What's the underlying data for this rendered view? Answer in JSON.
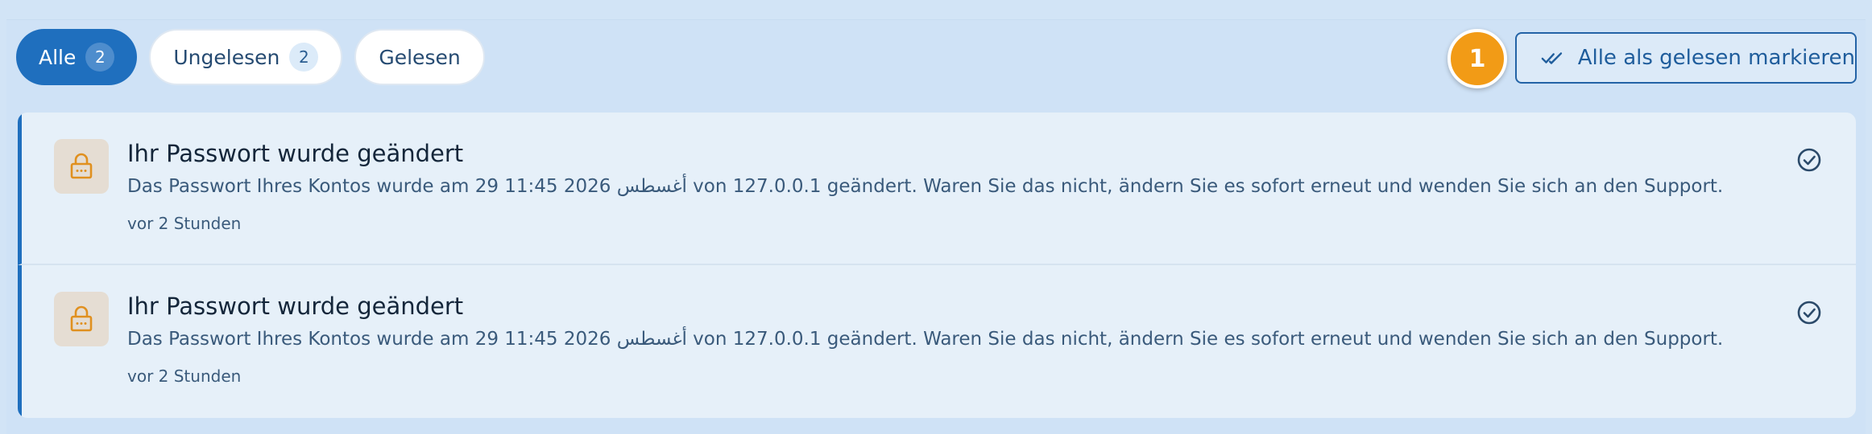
{
  "tabs": [
    {
      "label": "Alle",
      "count": "2",
      "active": true
    },
    {
      "label": "Ungelesen",
      "count": "2",
      "active": false
    },
    {
      "label": "Gelesen",
      "active": false
    }
  ],
  "step_marker": "1",
  "mark_all": {
    "label": "Alle als gelesen markieren",
    "icon": "double-check-icon"
  },
  "notifications": [
    {
      "icon": "lock-icon",
      "title": "Ihr Passwort wurde geändert",
      "message": "Das Passwort Ihres Kontos wurde am 29 أغسطس 2026 11:45 von 127.0.0.1 geändert. Waren Sie das nicht, ändern Sie es sofort erneut und wenden Sie sich an den Support.",
      "time": "vor 2 Stunden",
      "action_icon": "check-circle-icon"
    },
    {
      "icon": "lock-icon",
      "title": "Ihr Passwort wurde geändert",
      "message": "Das Passwort Ihres Kontos wurde am 29 أغسطس 2026 11:45 von 127.0.0.1 geändert. Waren Sie das nicht, ändern Sie es sofort erneut und wenden Sie sich an den Support.",
      "time": "vor 2 Stunden",
      "action_icon": "check-circle-icon"
    }
  ],
  "colors": {
    "accent": "#1f6fbe",
    "marker": "#f29b16",
    "lock": "#e0901f"
  }
}
